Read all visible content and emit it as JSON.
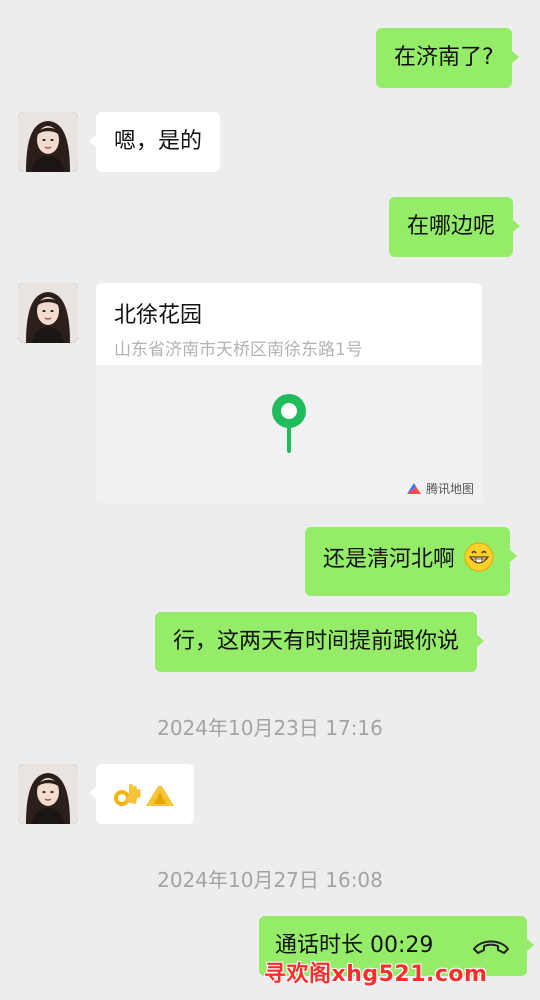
{
  "messages": {
    "m1": "在济南了?",
    "m2": "嗯，是的",
    "m3": "在哪边呢",
    "m5": "还是清河北啊",
    "m6": "行，这两天有时间提前跟你说"
  },
  "location": {
    "name": "北徐花园",
    "address": "山东省济南市天桥区南徐东路1号",
    "map_brand": "腾讯地图"
  },
  "timestamps": {
    "t1": "2024年10月23日 17:16",
    "t2": "2024年10月27日 16:08"
  },
  "call": {
    "label": "通话时长 00:29"
  },
  "watermark": "寻欢阁xhg521.com",
  "colors": {
    "my_bubble": "#95ec69",
    "other_bubble": "#ffffff",
    "background": "#ededed",
    "pin": "#1fbb5c"
  },
  "icons": {
    "emoji_grin": "grinning-face-icon",
    "ok_hand": "ok-hand-icon",
    "pinch_hand": "pinching-hand-icon",
    "call": "phone-hangup-icon",
    "location_pin": "location-pin-icon",
    "avatar": "contact-avatar"
  }
}
